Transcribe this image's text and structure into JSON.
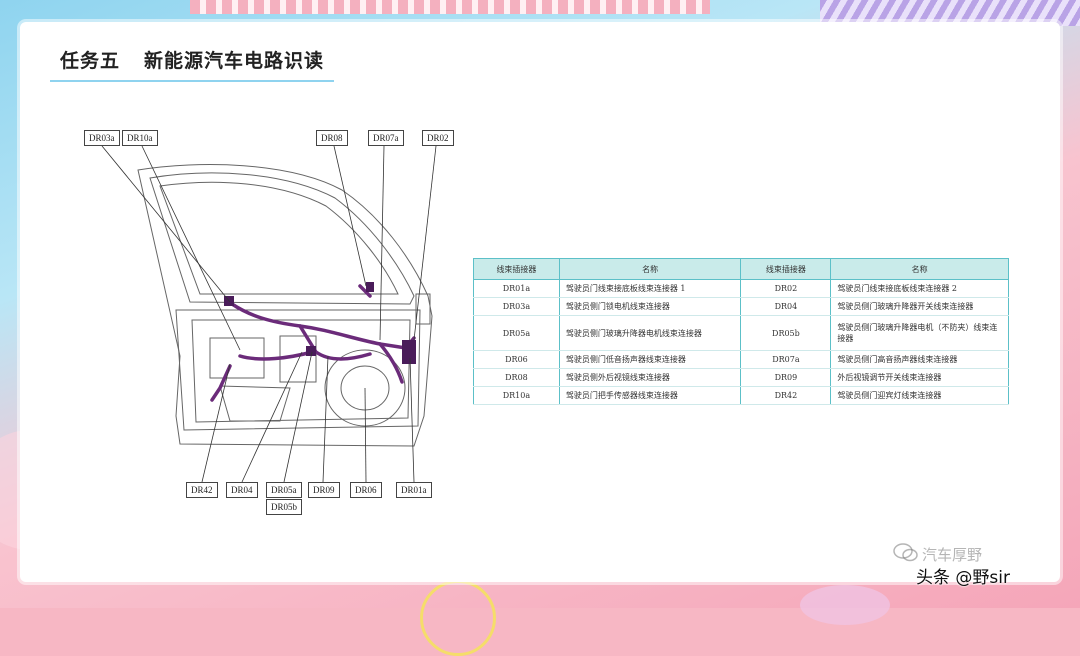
{
  "slide": {
    "task_label": "任务五",
    "title": "新能源汽车电路识读"
  },
  "diagram": {
    "top_labels": [
      "DR03a",
      "DR10a",
      "DR08",
      "DR07a",
      "DR02"
    ],
    "bottom_labels": [
      "DR42",
      "DR04",
      "DR05a",
      "DR05b",
      "DR09",
      "DR06",
      "DR01a"
    ]
  },
  "table": {
    "headers": [
      "线束插接器",
      "名称",
      "线束插接器",
      "名称"
    ],
    "rows": [
      [
        "DR01a",
        "驾驶员门线束接底板线束连接器 1",
        "DR02",
        "驾驶员门线束接底板线束连接器 2"
      ],
      [
        "DR03a",
        "驾驶员侧门锁电机线束连接器",
        "DR04",
        "驾驶员侧门玻璃升降器开关线束连接器"
      ],
      [
        "DR05a",
        "驾驶员侧门玻璃升降器电机线束连接器",
        "DR05b",
        "驾驶员侧门玻璃升降器电机（不防夹）线束连接器"
      ],
      [
        "DR06",
        "驾驶员侧门低音扬声器线束连接器",
        "DR07a",
        "驾驶员侧门高音扬声器线束连接器"
      ],
      [
        "DR08",
        "驾驶员侧外后视镜线束连接器",
        "DR09",
        "外后视镜调节开关线束连接器"
      ],
      [
        "DR10a",
        "驾驶员门把手传感器线束连接器",
        "DR42",
        "驾驶员侧门迎宾灯线束连接器"
      ]
    ]
  },
  "watermark": "汽车厚野",
  "credit": "头条 @野sir"
}
